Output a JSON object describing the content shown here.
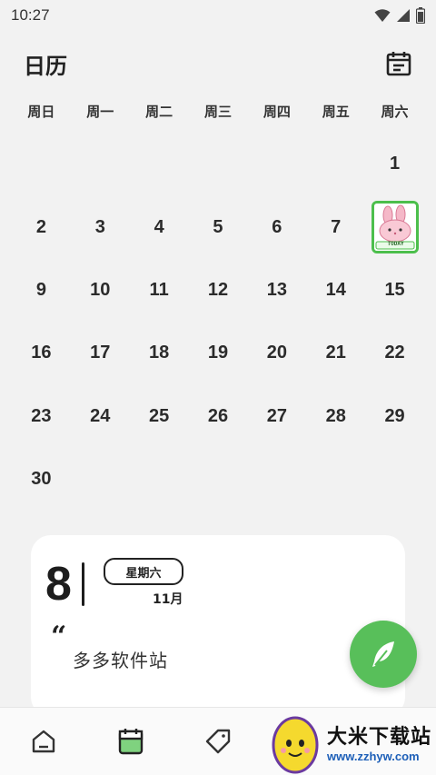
{
  "status_bar": {
    "time": "10:27"
  },
  "header": {
    "title": "日历"
  },
  "weekdays": [
    "周日",
    "周一",
    "周二",
    "周三",
    "周四",
    "周五",
    "周六"
  ],
  "calendar": {
    "days": [
      "",
      "",
      "",
      "",
      "",
      "",
      "1",
      "2",
      "3",
      "4",
      "5",
      "6",
      "7",
      "",
      "9",
      "10",
      "11",
      "12",
      "13",
      "14",
      "15",
      "16",
      "17",
      "18",
      "19",
      "20",
      "21",
      "22",
      "23",
      "24",
      "25",
      "26",
      "27",
      "28",
      "29",
      "30"
    ],
    "sticker_day_index": 13,
    "sticker_caption": "TODAY"
  },
  "detail": {
    "day": "8",
    "weekday": "星期六",
    "month": "11月",
    "quote_mark": "“",
    "quote": "多多软件站"
  },
  "colors": {
    "accent": "#58bf5a",
    "sticker_border": "#4cbf4c",
    "background": "#f2f2f2"
  },
  "bottom_nav": {
    "items": [
      {
        "icon": "home-icon",
        "active": false
      },
      {
        "icon": "calendar-icon",
        "active": true
      },
      {
        "icon": "tag-icon",
        "active": false
      }
    ]
  },
  "watermark": {
    "title": "大米下载站",
    "url": "www.zzhyw.com"
  }
}
